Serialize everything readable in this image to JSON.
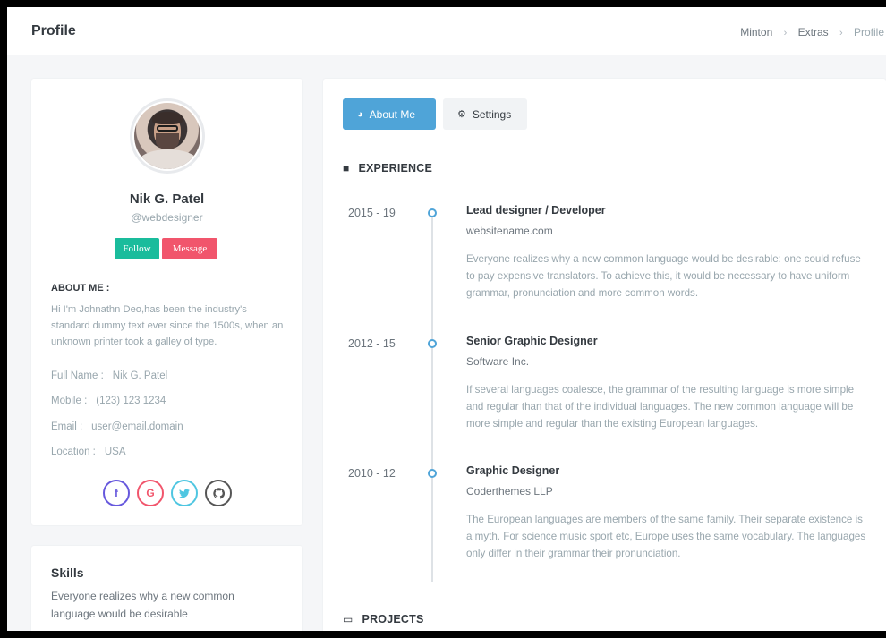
{
  "header": {
    "title": "Profile",
    "breadcrumb": [
      "Minton",
      "Extras",
      "Profile"
    ]
  },
  "profile": {
    "name": "Nik G. Patel",
    "handle": "@webdesigner",
    "follow_label": "Follow",
    "message_label": "Message",
    "about_heading": "ABOUT ME :",
    "about_text": "Hi I'm Johnathn Deo,has been the industry's standard dummy text ever since the 1500s, when an unknown printer took a galley of type.",
    "info": [
      {
        "label": "Full Name :",
        "value": "Nik G. Patel"
      },
      {
        "label": "Mobile :",
        "value": "(123) 123 1234"
      },
      {
        "label": "Email :",
        "value": "user@email.domain"
      },
      {
        "label": "Location :",
        "value": "USA"
      }
    ],
    "socials": [
      {
        "icon": "facebook-icon",
        "glyph": "f"
      },
      {
        "icon": "google-icon",
        "glyph": "G"
      },
      {
        "icon": "twitter-icon",
        "glyph": "🐦"
      },
      {
        "icon": "github-icon",
        "glyph": "◉"
      }
    ]
  },
  "skills": {
    "title": "Skills",
    "text": "Everyone realizes why a new common language would be desirable"
  },
  "tabs": [
    {
      "label": "About Me",
      "icon": "user-circle-icon",
      "active": true
    },
    {
      "label": "Settings",
      "icon": "gear-icon",
      "active": false
    }
  ],
  "experience": {
    "heading": "EXPERIENCE",
    "items": [
      {
        "date": "2015 - 19",
        "title": "Lead designer / Developer",
        "company": "websitename.com",
        "description": "Everyone realizes why a new common language would be desirable: one could refuse to pay expensive translators. To achieve this, it would be necessary to have uniform grammar, pronunciation and more common words."
      },
      {
        "date": "2012 - 15",
        "title": "Senior Graphic Designer",
        "company": "Software Inc.",
        "description": "If several languages coalesce, the grammar of the resulting language is more simple and regular than that of the individual languages. The new common language will be more simple and regular than the existing European languages."
      },
      {
        "date": "2010 - 12",
        "title": "Graphic Designer",
        "company": "Coderthemes LLP",
        "description": "The European languages are members of the same family. Their separate existence is a myth. For science music sport etc, Europe uses the same vocabulary. The languages only differ in their grammar their pronunciation."
      }
    ]
  },
  "projects": {
    "heading": "PROJECTS"
  },
  "colors": {
    "accent": "#4fa4d8",
    "follow": "#1abc9c",
    "message": "#f1556c"
  }
}
